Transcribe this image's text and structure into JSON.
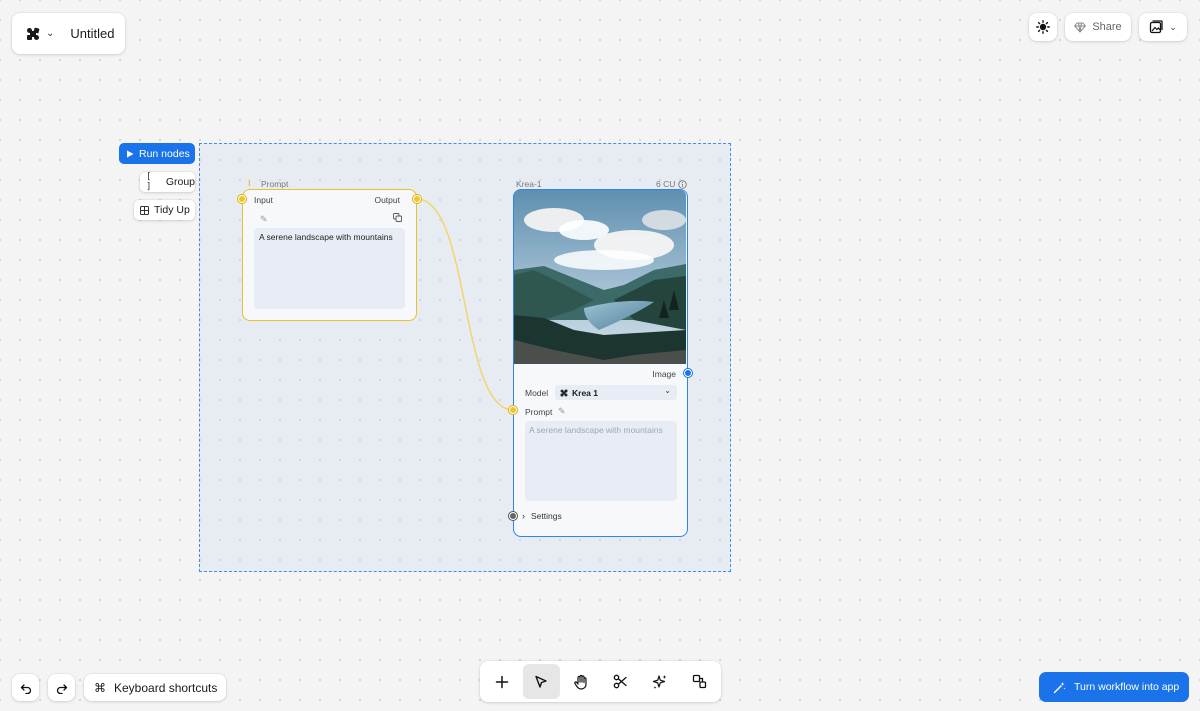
{
  "project": {
    "title": "Untitled",
    "logo_icon": "krea-logo-icon"
  },
  "topbar": {
    "share_label": "Share",
    "theme_icon": "sun-icon",
    "gallery_icon": "image-gallery-icon"
  },
  "selection_actions": {
    "run_label": "Run nodes",
    "group_label": "Group",
    "tidy_label": "Tidy Up"
  },
  "prompt_node": {
    "title": "Prompt",
    "input_label": "Input",
    "output_label": "Output",
    "text": "A serene landscape with mountains"
  },
  "krea_node": {
    "title": "Krea-1",
    "cost": "6 CU",
    "image_label": "Image",
    "model_label": "Model",
    "model_value": "Krea 1",
    "prompt_label": "Prompt",
    "prompt_placeholder": "A serene landscape with mountains",
    "settings_label": "Settings"
  },
  "bottom": {
    "shortcuts_label": "Keyboard shortcuts",
    "turn_app_label": "Turn workflow into app",
    "tools": [
      "plus-icon",
      "pointer-icon",
      "hand-icon",
      "scissors-icon",
      "sparkles-icon",
      "shapes-icon"
    ]
  },
  "colors": {
    "accent": "#1a73e8",
    "prompt_border": "#e7c12f",
    "model_border": "#2d86ea"
  }
}
